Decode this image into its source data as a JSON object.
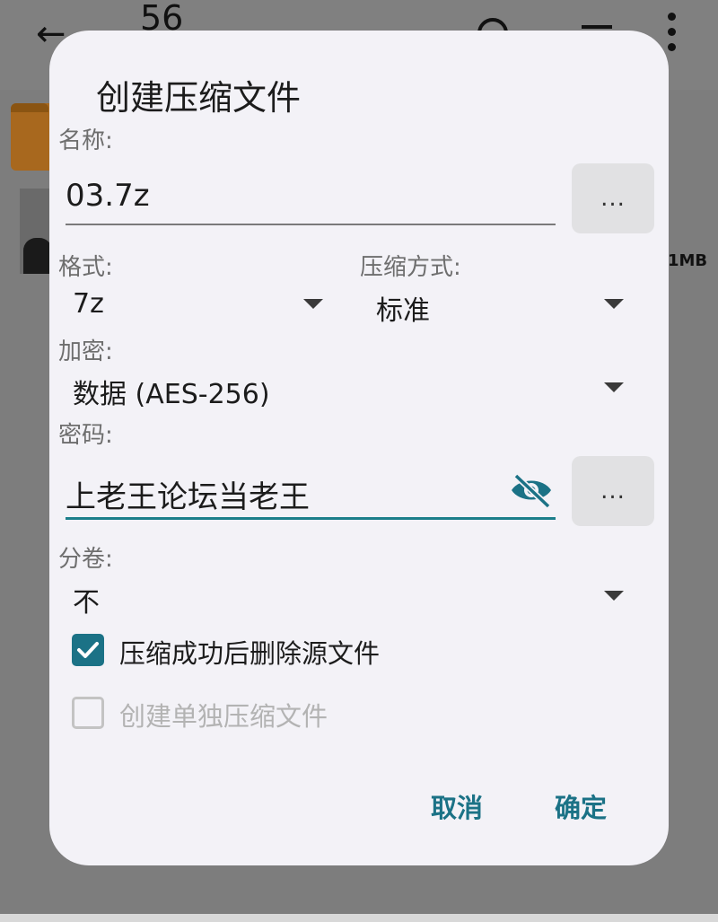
{
  "background": {
    "title": "56",
    "back_icon": "arrow-left-icon",
    "size_text": "1MB"
  },
  "dialog": {
    "title": "创建压缩文件",
    "name_label": "名称:",
    "name_value": "03.7z",
    "browse_label": "...",
    "format_label": "格式:",
    "format_value": "7z",
    "method_label": "压缩方式:",
    "method_value": "标准",
    "encryption_label": "加密:",
    "encryption_value": "数据 (AES-256)",
    "password_label": "密码:",
    "password_value": "上老王论坛当老王",
    "password_more_label": "...",
    "split_label": "分卷:",
    "split_value": "不",
    "delete_source_label": "压缩成功后删除源文件",
    "delete_source_checked": true,
    "separate_label": "创建单独压缩文件",
    "separate_checked": false,
    "cancel_label": "取消",
    "ok_label": "确定"
  },
  "colors": {
    "accent": "#1b7286",
    "dialog_bg": "#f3f2f7",
    "scrim": "#7d7d7d"
  }
}
